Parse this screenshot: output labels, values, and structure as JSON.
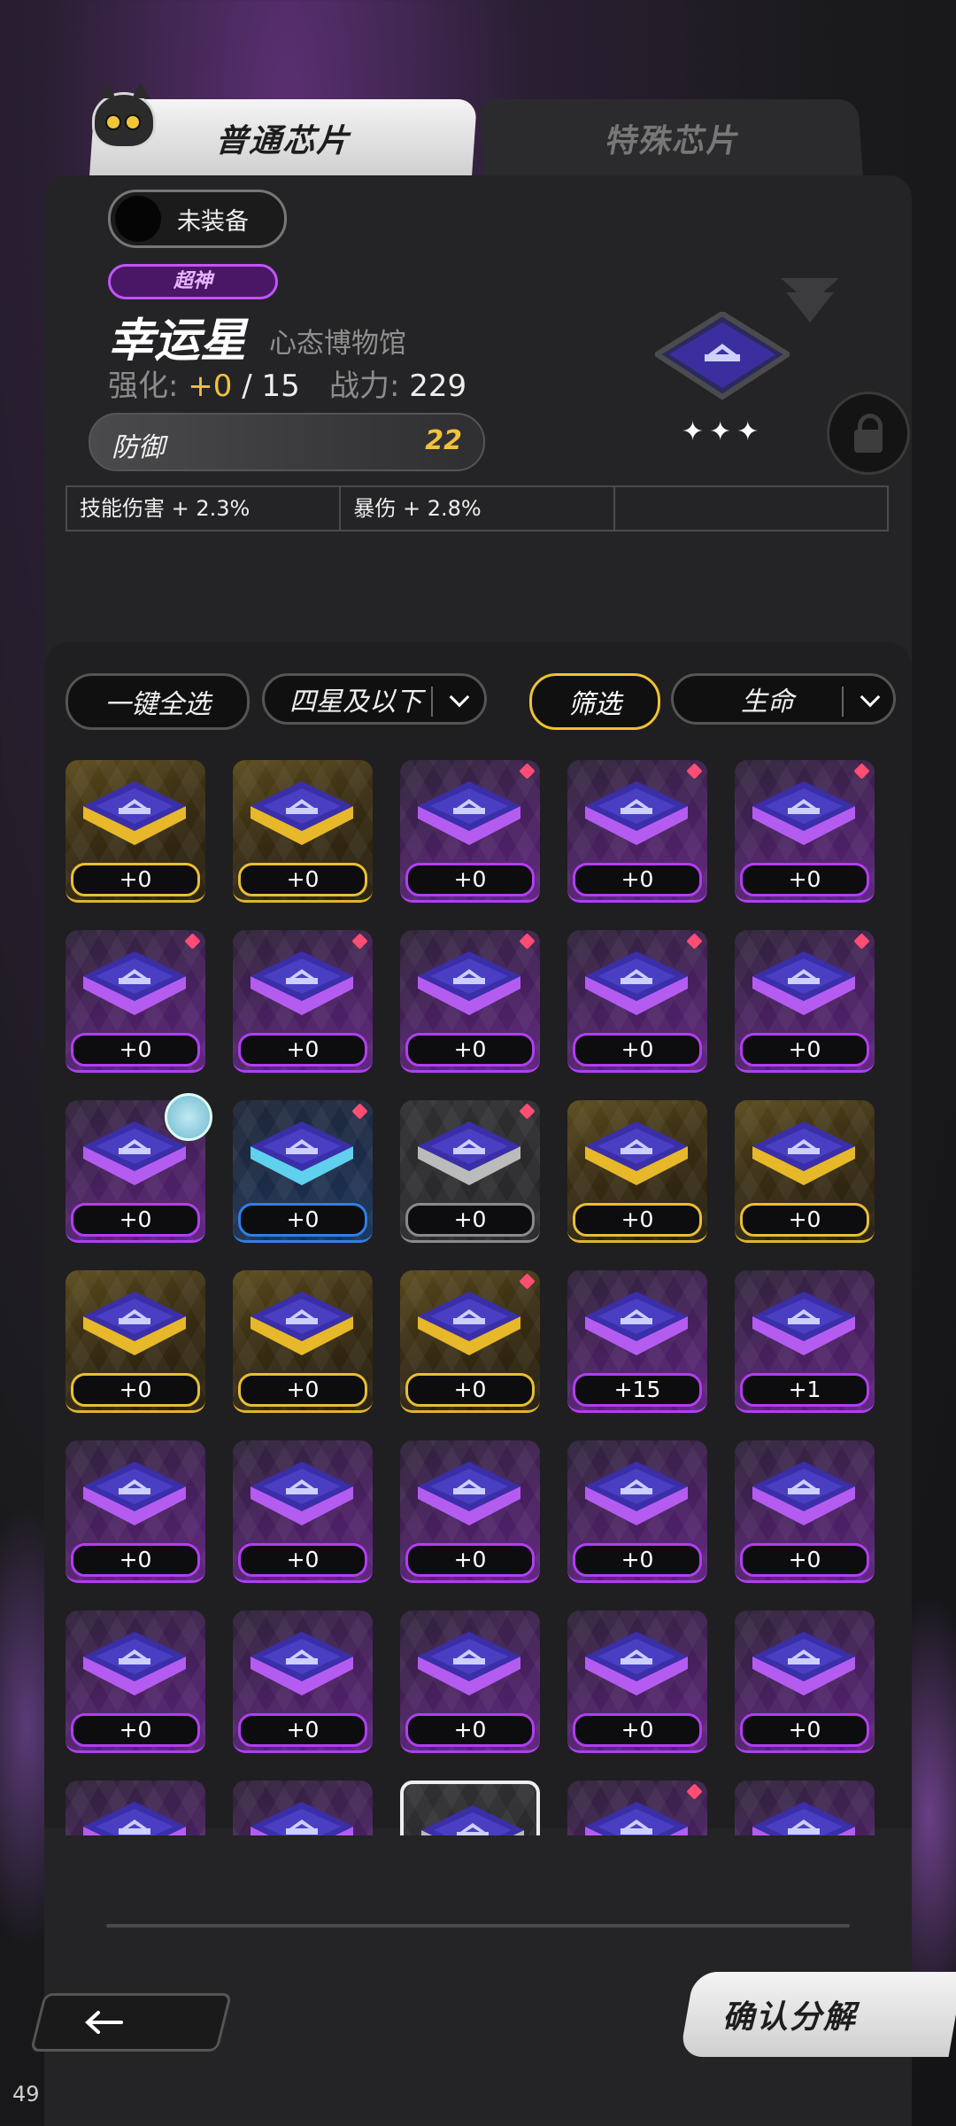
{
  "tabs": {
    "normal": "普通芯片",
    "special": "特殊芯片"
  },
  "equip_toggle": {
    "label": "未装备"
  },
  "chip": {
    "rarity": "超神",
    "name": "幸运星",
    "set": "心态博物馆",
    "enhance_label": "强化:",
    "enhance_current": "+0",
    "enhance_sep": "/",
    "enhance_max": "15",
    "power_label": "战力:",
    "power_value": "229",
    "main_stat": {
      "name": "防御",
      "value": "22"
    },
    "sub_stats": [
      "技能伤害 + 2.3%",
      "暴伤 + 2.8%",
      ""
    ],
    "stars": "✦✦✦"
  },
  "controls": {
    "select_all": "一键全选",
    "star_filter": "四星及以下",
    "filter": "筛选",
    "sort": "生命"
  },
  "grid": [
    {
      "rarity": "gold",
      "level": "+0",
      "mark": false
    },
    {
      "rarity": "gold",
      "level": "+0",
      "mark": false
    },
    {
      "rarity": "purple",
      "level": "+0",
      "mark": true
    },
    {
      "rarity": "purple",
      "level": "+0",
      "mark": true
    },
    {
      "rarity": "purple",
      "level": "+0",
      "mark": true
    },
    {
      "rarity": "purple",
      "level": "+0",
      "mark": true
    },
    {
      "rarity": "purple",
      "level": "+0",
      "mark": true
    },
    {
      "rarity": "purple",
      "level": "+0",
      "mark": true
    },
    {
      "rarity": "purple",
      "level": "+0",
      "mark": true
    },
    {
      "rarity": "purple",
      "level": "+0",
      "mark": true
    },
    {
      "rarity": "purple",
      "level": "+0",
      "mark": false,
      "equipped": true
    },
    {
      "rarity": "blue",
      "level": "+0",
      "mark": true
    },
    {
      "rarity": "gray",
      "level": "+0",
      "mark": true
    },
    {
      "rarity": "gold",
      "level": "+0",
      "mark": false
    },
    {
      "rarity": "gold",
      "level": "+0",
      "mark": false
    },
    {
      "rarity": "gold",
      "level": "+0",
      "mark": false
    },
    {
      "rarity": "gold",
      "level": "+0",
      "mark": false
    },
    {
      "rarity": "gold",
      "level": "+0",
      "mark": true
    },
    {
      "rarity": "purple",
      "level": "+15",
      "mark": false
    },
    {
      "rarity": "purple",
      "level": "+1",
      "mark": false
    },
    {
      "rarity": "purple",
      "level": "+0",
      "mark": false
    },
    {
      "rarity": "purple",
      "level": "+0",
      "mark": false
    },
    {
      "rarity": "purple",
      "level": "+0",
      "mark": false
    },
    {
      "rarity": "purple",
      "level": "+0",
      "mark": false
    },
    {
      "rarity": "purple",
      "level": "+0",
      "mark": false
    },
    {
      "rarity": "purple",
      "level": "+0",
      "mark": false
    },
    {
      "rarity": "purple",
      "level": "+0",
      "mark": false
    },
    {
      "rarity": "purple",
      "level": "+0",
      "mark": false
    },
    {
      "rarity": "purple",
      "level": "+0",
      "mark": false
    },
    {
      "rarity": "purple",
      "level": "+0",
      "mark": false
    },
    {
      "rarity": "purple",
      "level": "",
      "mark": false
    },
    {
      "rarity": "purple",
      "level": "",
      "mark": false
    },
    {
      "rarity": "gray",
      "level": "",
      "mark": false,
      "selected": true
    },
    {
      "rarity": "purple",
      "level": "",
      "mark": true
    },
    {
      "rarity": "purple",
      "level": "",
      "mark": false
    }
  ],
  "confirm_button": "确认分解",
  "page_number": "49",
  "colors": {
    "gold": "#e0b52d",
    "purple": "#b13ef2",
    "blue": "#2f7fe6",
    "gray": "#8a8a8a",
    "accent": "#f0c232",
    "new_mark": "#ff4d73"
  }
}
